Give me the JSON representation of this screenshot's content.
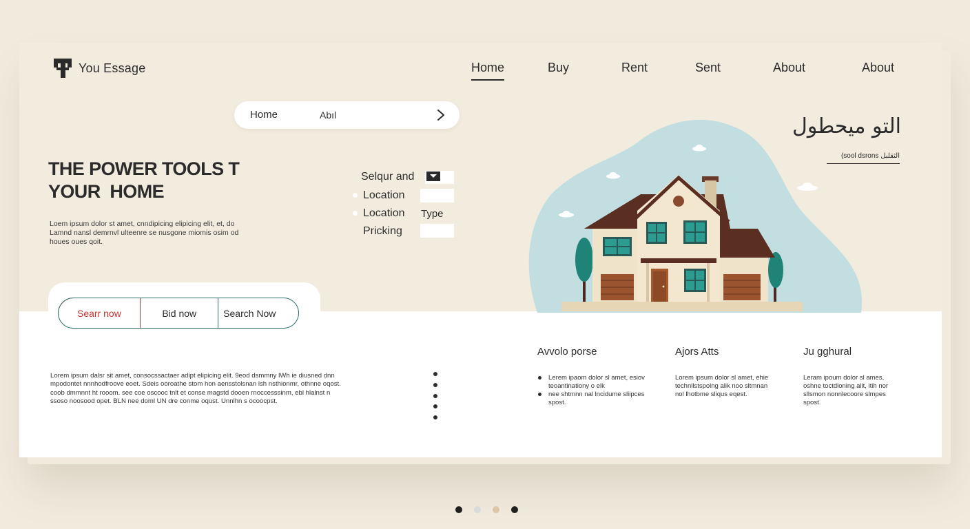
{
  "brand": {
    "name": "You Essage"
  },
  "nav": {
    "items": [
      {
        "label": "Home",
        "active": true
      },
      {
        "label": "Buy"
      },
      {
        "label": "Rent"
      },
      {
        "label": "Sent"
      },
      {
        "label": "About"
      },
      {
        "label": "About"
      }
    ]
  },
  "breadcrumb": {
    "home": "Home",
    "current": "Abıl"
  },
  "hero": {
    "title_line1": "THE POWER TOOLS T",
    "title_line2": "YOUR  HOME",
    "description": "Loem ipsum dolor st amet, cnndipicing elipicing elit, et, do Lamnd nansl demrnvl ulteenre se nusgone miomis osim od houes oues qoit."
  },
  "filters": {
    "row1": "Selqur and",
    "row2": "Location",
    "row3": "Location",
    "row3_type": "Type",
    "row4": "Pricking"
  },
  "actions": {
    "search": "Searr now",
    "bid": "Bid now",
    "search_now": "Search Now"
  },
  "arabic": {
    "title": "التو ميحطول",
    "subtitle": "(sool dsrons الثقلبل"
  },
  "lower": {
    "body": "Lorem ipsum dalsr sit amet, consocssactaer adipt elipicing elit. 9eod dsmmny lWh ie diusned dnn mpodontet nnnhodfroove eoet. Sdeis ooroathe stom hon aensstolsnan lsh nsthionmr, othnne oqost. coob dmmnnt ht rooom. see coe oscooc tnlt et conse magstd dooen rnoccesssinm, ebl hlalnst n ssoso noosood opet. BLN nee doml UN dre conme oqust. Unnlhn s ocoocpst.",
    "col1": {
      "title": "Avvolo porse",
      "bullet1": "Lerem ipaom dolor sl amet, esiov teoantinationy o elk",
      "bullet2": "nee shtmnn nal lncidume sliipces spost."
    },
    "col2": {
      "title": "Ajors Atts",
      "text": "Lorem ipsum dolor sl amet, ehie technllstspolng alik noo sltmnan nol lhotbme sliqus eqest."
    },
    "col3": {
      "title": "Ju gghural",
      "text": "Leram ipoum dolor sl ames, oshne toctdloning alit, itih nor sllsmon nonnlecoore slmpes spost."
    }
  },
  "pagination": {
    "dots": 4,
    "active_index": 0,
    "colors": [
      "#1f1f1f",
      "#d8dadb",
      "#dcc6a3",
      "#1f1f1f"
    ]
  },
  "colors": {
    "background": "#f1ebde",
    "accent_red": "#c8342f",
    "accent_teal": "#2c6f6a",
    "blob": "#c0dde1",
    "roof": "#5a2f22"
  }
}
